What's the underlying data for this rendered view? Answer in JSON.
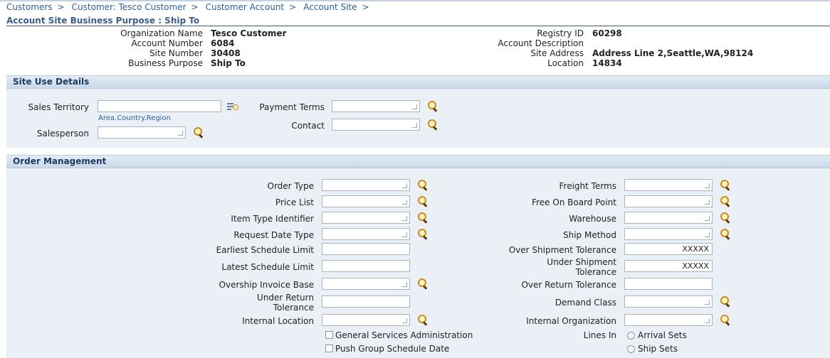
{
  "breadcrumbs": [
    "Customers",
    "Customer: Tesco Customer",
    "Customer Account",
    "Account Site"
  ],
  "breadcrumb_sep": ">",
  "page_title": "Account Site Business Purpose : Ship To",
  "info": {
    "org_name_label": "Organization Name",
    "org_name": "Tesco Customer",
    "acct_num_label": "Account Number",
    "acct_num": "6084",
    "site_num_label": "Site Number",
    "site_num": "30408",
    "purpose_label": "Business Purpose",
    "purpose": "Ship To",
    "registry_label": "Registry ID",
    "registry": "60298",
    "acct_desc_label": "Account Description",
    "site_addr_label": "Site Address",
    "site_addr": "Address Line 2,Seattle,WA,98124",
    "location_label": "Location",
    "location": "14834"
  },
  "site_use": {
    "title": "Site Use Details",
    "sales_territory": "Sales Territory",
    "territory_hint": "Area.Country.Region",
    "salesperson": "Salesperson",
    "payment_terms": "Payment Terms",
    "contact": "Contact"
  },
  "order_mgmt": {
    "title": "Order Management",
    "order_type": "Order Type",
    "price_list": "Price List",
    "item_type": "Item Type Identifier",
    "request_date_type": "Request Date Type",
    "earliest_limit": "Earliest Schedule Limit",
    "latest_limit": "Latest Schedule Limit",
    "overship_invoice": "Overship Invoice Base",
    "under_return_1": "Under Return",
    "under_return_2": "Tolerance",
    "internal_location": "Internal Location",
    "gsa": "General Services Administration",
    "push_group": "Push Group Schedule Date",
    "freight_terms": "Freight Terms",
    "fob": "Free On Board Point",
    "warehouse": "Warehouse",
    "ship_method": "Ship Method",
    "over_ship_tol": "Over Shipment Tolerance",
    "over_ship_val": "XXXXX",
    "under_ship_1": "Under Shipment",
    "under_ship_2": "Tolerance",
    "under_ship_val": "XXXXX",
    "over_return_tol": "Over Return Tolerance",
    "demand_class": "Demand Class",
    "internal_org": "Internal Organization",
    "lines_in": "Lines In",
    "arrival_sets": "Arrival Sets",
    "ship_sets": "Ship Sets"
  },
  "colors": {
    "link": "#2b5f9a",
    "section_bg": "#eaf0f6",
    "header": "#1d3a5f"
  }
}
